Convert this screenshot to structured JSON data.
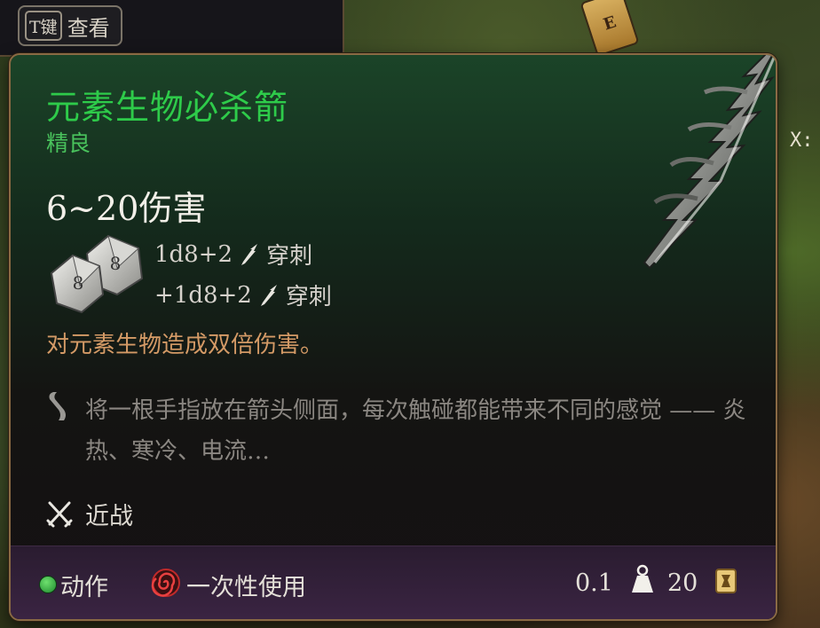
{
  "key_hint": {
    "key": "T键",
    "label": "查看"
  },
  "background": {
    "coord_label": "X:",
    "marker_letter": "E"
  },
  "item": {
    "name": "元素生物必杀箭",
    "rarity": "精良",
    "damage_total": "6~20伤害",
    "damage_rows": [
      {
        "dice": "1d8+2",
        "type": "穿刺"
      },
      {
        "dice": "+1d8+2",
        "type": "穿刺"
      }
    ],
    "special_effect": "对元素生物造成双倍伤害。",
    "flavor_text": "将一根手指放在箭头侧面，每次触碰都能带来不同的感觉 —— 炎热、寒冷、电流…",
    "attack_type": "近战"
  },
  "footer": {
    "action": "动作",
    "usage": "一次性使用",
    "weight": "0.1",
    "price": "20"
  },
  "colors": {
    "name_green": "#2ecb4a",
    "rarity_green": "#49c25c",
    "effect_orange": "#d49a66",
    "flavor_gray": "#8b8782",
    "frame_gold": "#8a6a44"
  },
  "icons": {
    "dice": "d8-dice-pair-icon",
    "damage_type": "piercing-arrow-icon",
    "flavor": "scroll-icon",
    "melee": "crossed-swords-icon",
    "action": "green-action-dot-icon",
    "usage": "red-spiral-icon",
    "weight": "weight-icon",
    "price": "gold-coin-icon"
  }
}
